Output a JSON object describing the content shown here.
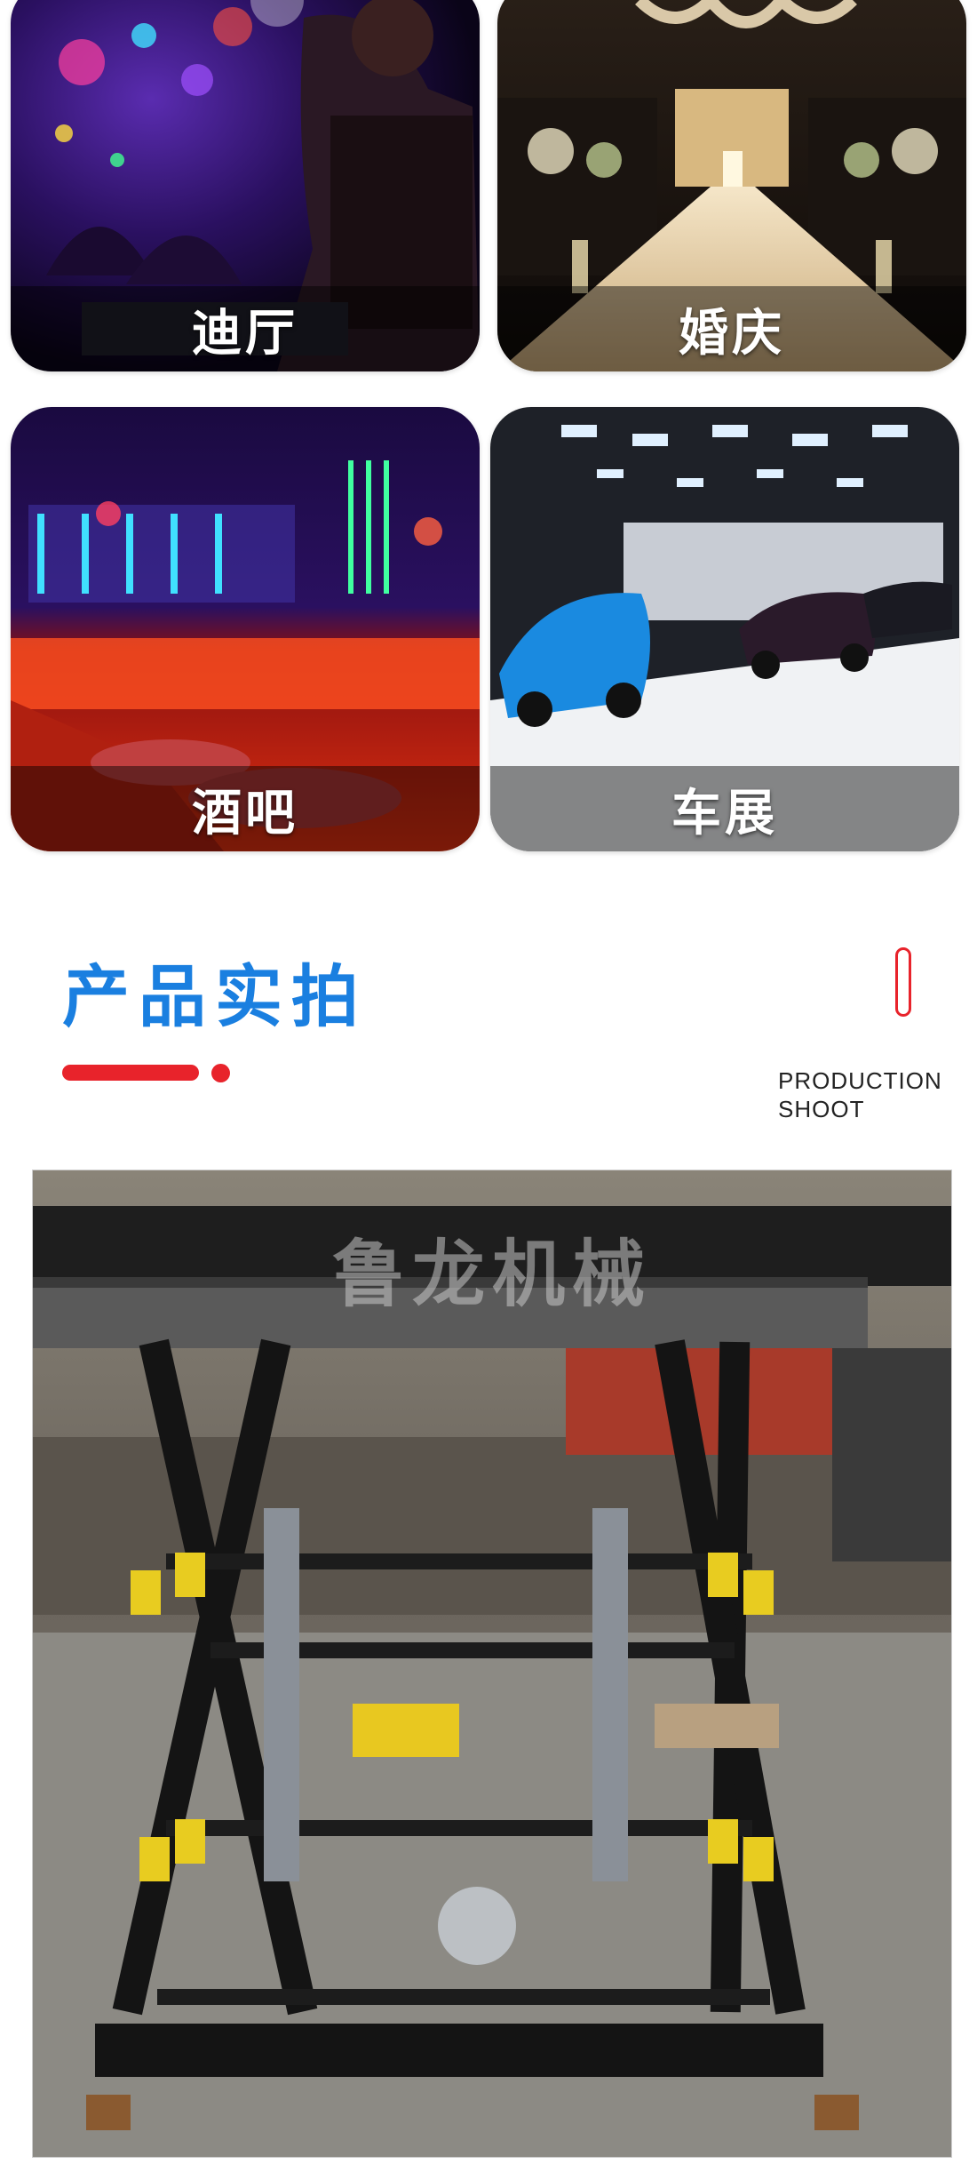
{
  "venues": [
    {
      "id": "disco",
      "label": "迪厅"
    },
    {
      "id": "wedding",
      "label": "婚庆"
    },
    {
      "id": "bar",
      "label": "酒吧"
    },
    {
      "id": "autoshow",
      "label": "车展"
    }
  ],
  "section": {
    "title": "产品实拍",
    "subtitle_line1": "PRODUCTION",
    "subtitle_line2": "SHOOT",
    "accent_color": "#e8232b",
    "title_color": "#1a7fe0"
  },
  "product_photo": {
    "watermark": "鲁龙机械"
  }
}
